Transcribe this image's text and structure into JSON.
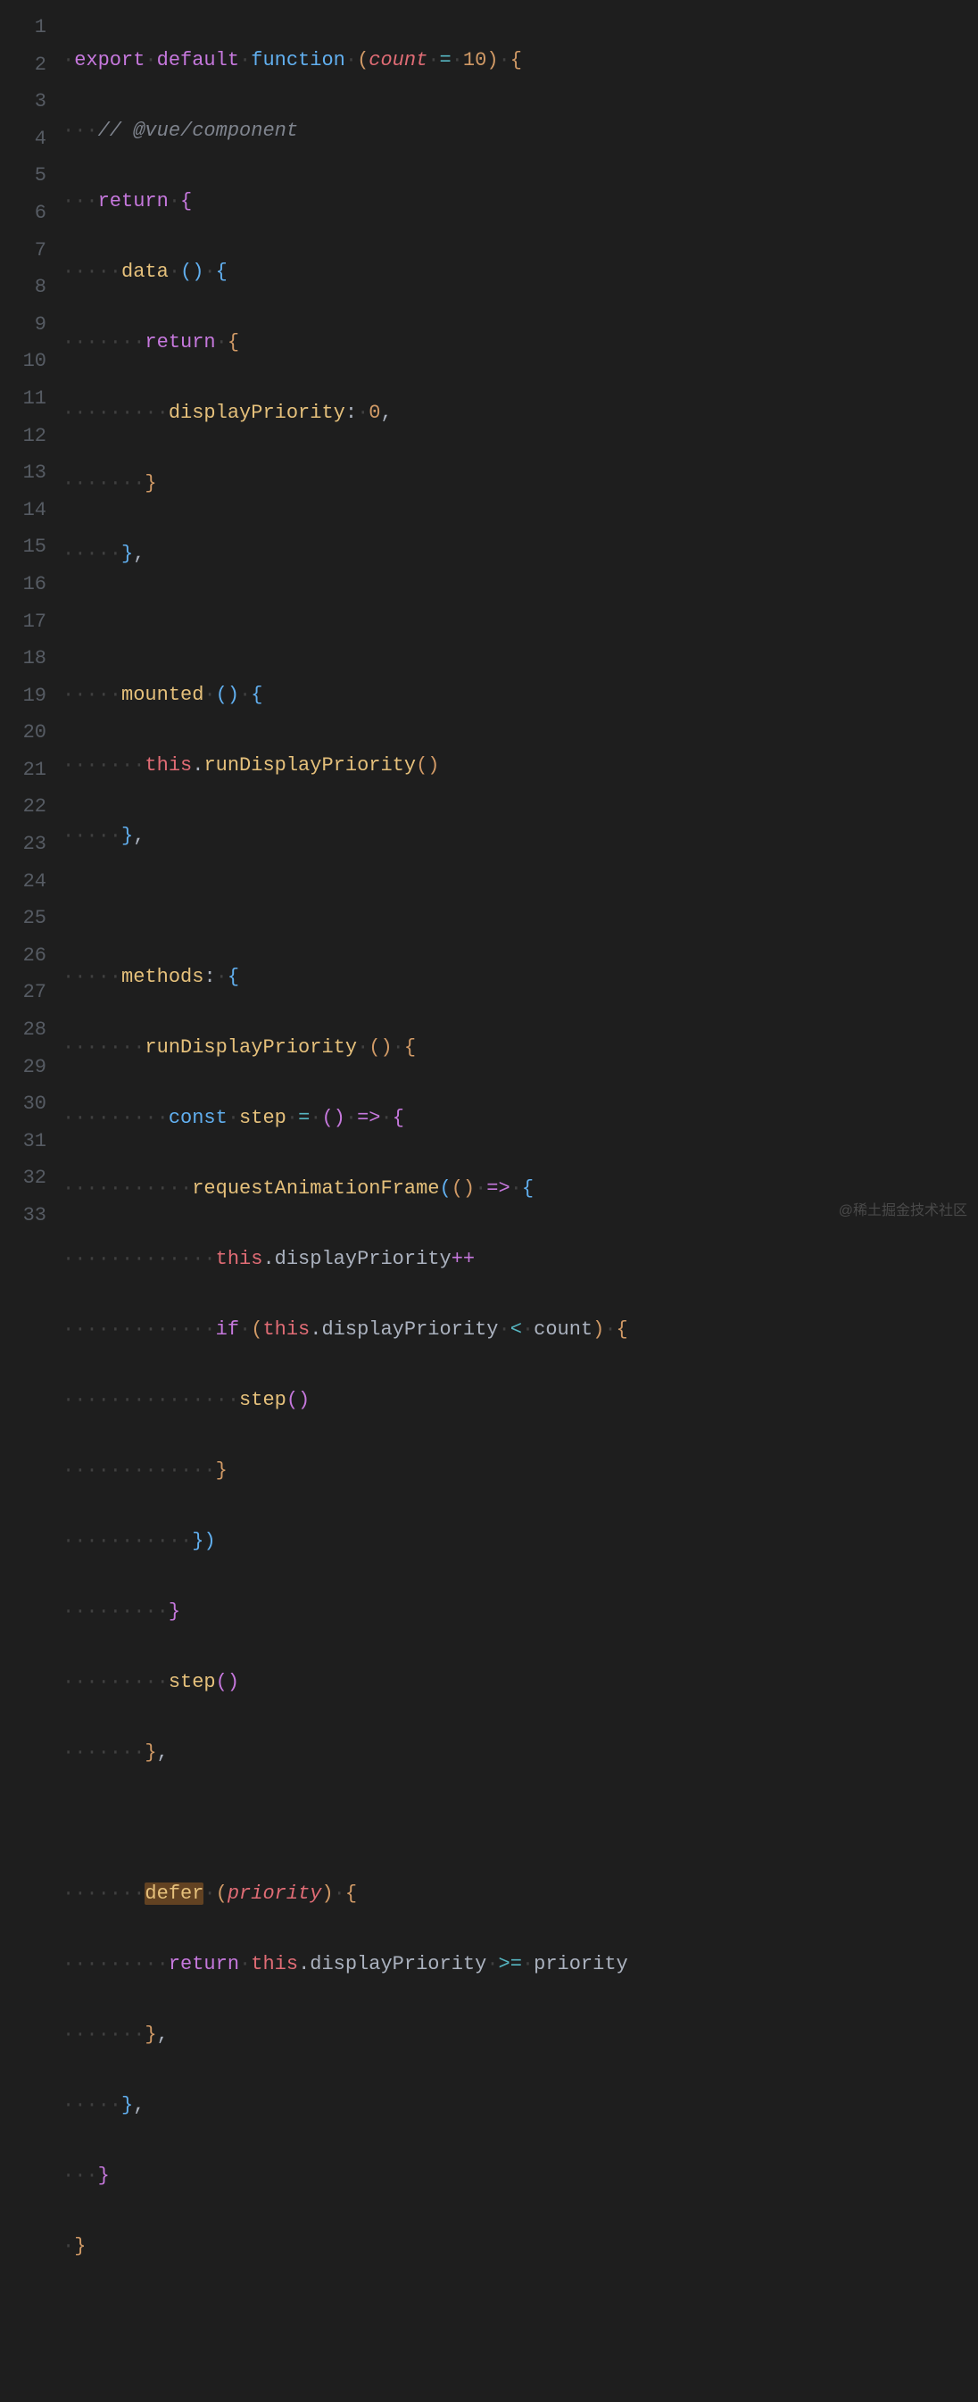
{
  "watermark": "@稀土掘金技术社区",
  "lineNumbers": [
    "1",
    "2",
    "3",
    "4",
    "5",
    "6",
    "7",
    "8",
    "9",
    "10",
    "11",
    "12",
    "13",
    "14",
    "15",
    "16",
    "17",
    "18",
    "19",
    "20",
    "21",
    "22",
    "23",
    "24",
    "25",
    "26",
    "27",
    "28",
    "29",
    "30",
    "31",
    "32",
    "33"
  ],
  "tokens": {
    "l1": {
      "export": "export",
      "default": "default",
      "function": "function",
      "count": "count",
      "eq": "=",
      "ten": "10"
    },
    "l2": {
      "comment": "// @vue/component"
    },
    "l3": {
      "return": "return"
    },
    "l4": {
      "data": "data"
    },
    "l5": {
      "return": "return"
    },
    "l6": {
      "displayPriority": "displayPriority",
      "zero": "0"
    },
    "l10": {
      "mounted": "mounted"
    },
    "l11": {
      "this": "this",
      "runDisplayPriority": "runDisplayPriority"
    },
    "l14": {
      "methods": "methods"
    },
    "l15": {
      "runDisplayPriority": "runDisplayPriority"
    },
    "l16": {
      "const": "const",
      "step": "step",
      "eq": "="
    },
    "l17": {
      "requestAnimationFrame": "requestAnimationFrame"
    },
    "l18": {
      "this": "this",
      "displayPriority": "displayPriority",
      "pp": "++"
    },
    "l19": {
      "if": "if",
      "this": "this",
      "displayPriority": "displayPriority",
      "lt": "<",
      "count": "count"
    },
    "l20": {
      "step": "step"
    },
    "l24": {
      "step": "step"
    },
    "l27": {
      "defer": "defer",
      "priority": "priority"
    },
    "l28": {
      "return": "return",
      "this": "this",
      "displayPriority": "displayPriority",
      "gte": ">=",
      "priority": "priority"
    }
  }
}
